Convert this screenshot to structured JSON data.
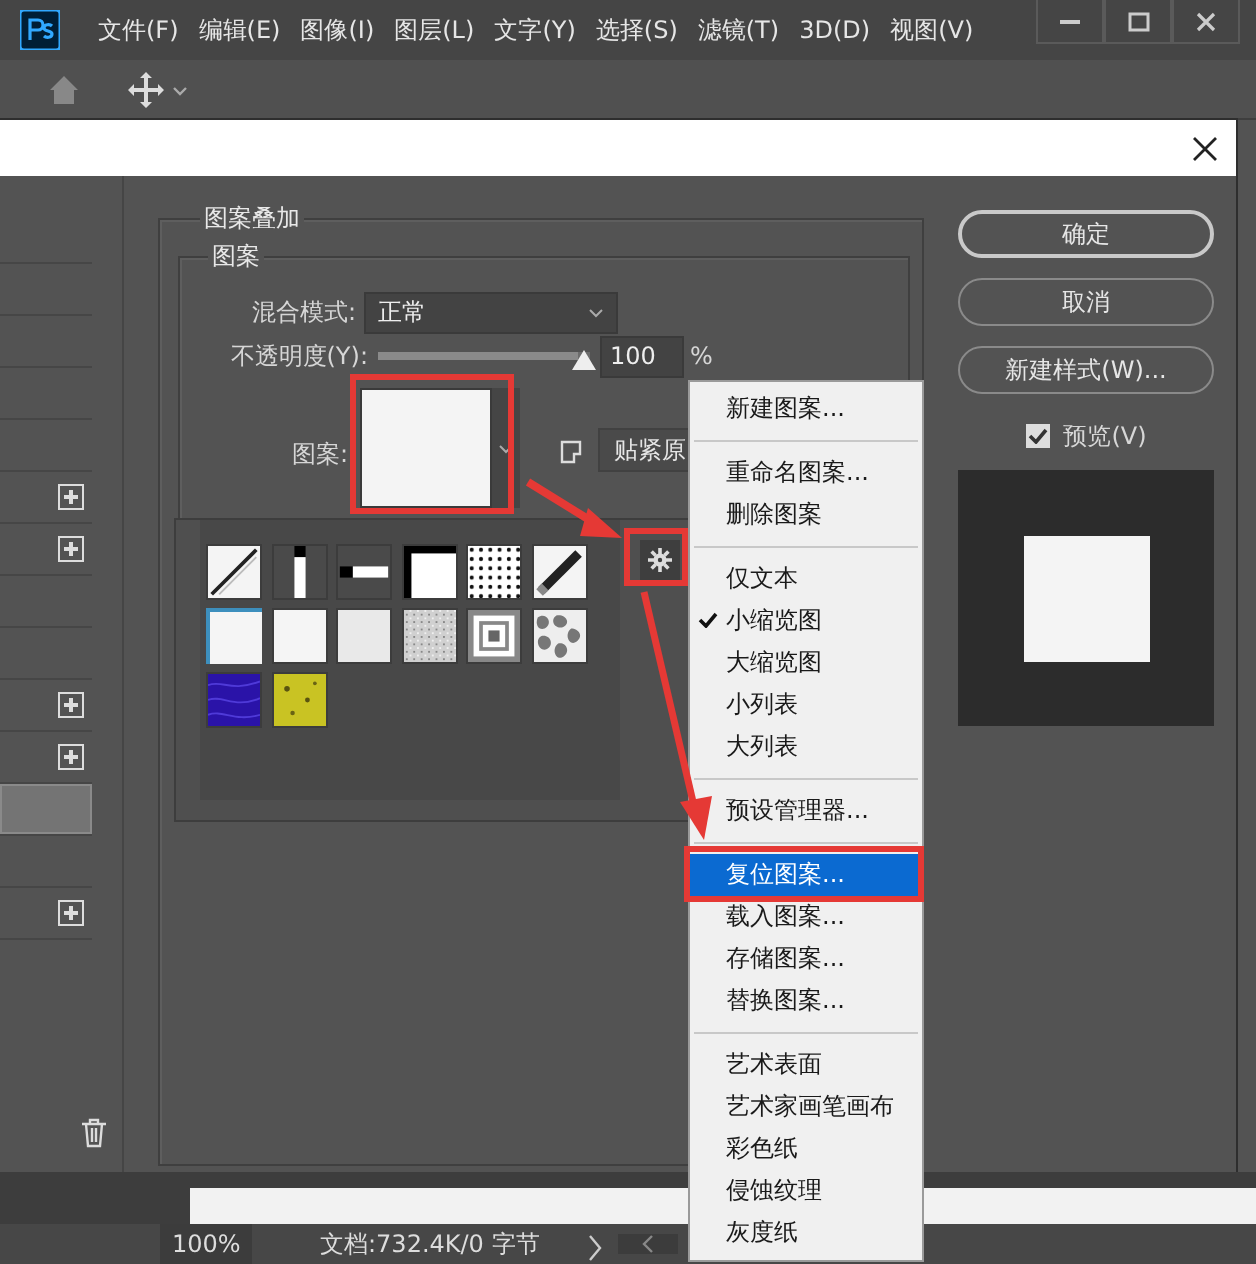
{
  "menubar": {
    "items": [
      "文件(F)",
      "编辑(E)",
      "图像(I)",
      "图层(L)",
      "文字(Y)",
      "选择(S)",
      "滤镜(T)",
      "3D(D)",
      "视图(V)"
    ]
  },
  "dialog": {
    "left_list": [
      {
        "add": false,
        "selected": false
      },
      {
        "add": false,
        "selected": false
      },
      {
        "add": false,
        "selected": false
      },
      {
        "add": false,
        "selected": false
      },
      {
        "add": false,
        "selected": false
      },
      {
        "add": true,
        "selected": false
      },
      {
        "add": true,
        "selected": false
      },
      {
        "add": false,
        "selected": false
      },
      {
        "add": false,
        "selected": false
      },
      {
        "add": true,
        "selected": false
      },
      {
        "add": true,
        "selected": false
      },
      {
        "add": false,
        "selected": true
      },
      {
        "add": false,
        "selected": false
      },
      {
        "add": true,
        "selected": false
      }
    ],
    "group_title": "图案叠加",
    "section_title": "图案",
    "blend_mode": {
      "label": "混合模式:",
      "value": "正常"
    },
    "opacity": {
      "label": "不透明度(Y):",
      "level": 1,
      "value": "100",
      "unit": "%"
    },
    "pattern": {
      "label": "图案:",
      "snap_button": "贴紧原"
    },
    "pattern_picker": {
      "swatches": [
        {
          "kind": "diagonal",
          "selected": false
        },
        {
          "kind": "bar-vertical",
          "selected": false
        },
        {
          "kind": "bar-horizontal",
          "selected": false
        },
        {
          "kind": "frame",
          "selected": false
        },
        {
          "kind": "dots",
          "selected": false
        },
        {
          "kind": "diagonal-thick",
          "selected": false
        },
        {
          "kind": "white",
          "selected": true
        },
        {
          "kind": "white",
          "selected": false
        },
        {
          "kind": "light",
          "selected": false
        },
        {
          "kind": "noise",
          "selected": false
        },
        {
          "kind": "concentric",
          "selected": false
        },
        {
          "kind": "stone",
          "selected": false
        },
        {
          "kind": "blue",
          "selected": false
        },
        {
          "kind": "yellow",
          "selected": false
        }
      ]
    },
    "buttons": [
      "确定",
      "取消",
      "新建样式(W)..."
    ],
    "preview": {
      "label": "预览(V)",
      "checked": true
    }
  },
  "pattern_menu": {
    "items": [
      {
        "kind": "item",
        "label": "新建图案...",
        "checked": false,
        "selected": false
      },
      {
        "kind": "separator"
      },
      {
        "kind": "item",
        "label": "重命名图案...",
        "checked": false,
        "selected": false
      },
      {
        "kind": "item",
        "label": "删除图案",
        "checked": false,
        "selected": false
      },
      {
        "kind": "separator"
      },
      {
        "kind": "item",
        "label": "仅文本",
        "checked": false,
        "selected": false
      },
      {
        "kind": "item",
        "label": "小缩览图",
        "checked": true,
        "selected": false
      },
      {
        "kind": "item",
        "label": "大缩览图",
        "checked": false,
        "selected": false
      },
      {
        "kind": "item",
        "label": "小列表",
        "checked": false,
        "selected": false
      },
      {
        "kind": "item",
        "label": "大列表",
        "checked": false,
        "selected": false
      },
      {
        "kind": "separator"
      },
      {
        "kind": "item",
        "label": "预设管理器...",
        "checked": false,
        "selected": false
      },
      {
        "kind": "separator"
      },
      {
        "kind": "item",
        "label": "复位图案...",
        "checked": false,
        "selected": true
      },
      {
        "kind": "item",
        "label": "载入图案...",
        "checked": false,
        "selected": false
      },
      {
        "kind": "item",
        "label": "存储图案...",
        "checked": false,
        "selected": false
      },
      {
        "kind": "item",
        "label": "替换图案...",
        "checked": false,
        "selected": false
      },
      {
        "kind": "separator"
      },
      {
        "kind": "item",
        "label": "艺术表面",
        "checked": false,
        "selected": false
      },
      {
        "kind": "item",
        "label": "艺术家画笔画布",
        "checked": false,
        "selected": false
      },
      {
        "kind": "item",
        "label": "彩色纸",
        "checked": false,
        "selected": false
      },
      {
        "kind": "item",
        "label": "侵蚀纹理",
        "checked": false,
        "selected": false
      },
      {
        "kind": "item",
        "label": "灰度纸",
        "checked": false,
        "selected": false
      }
    ]
  },
  "status_bar": {
    "zoom": "100%",
    "doc_info": "文档:732.4K/0 字节"
  }
}
